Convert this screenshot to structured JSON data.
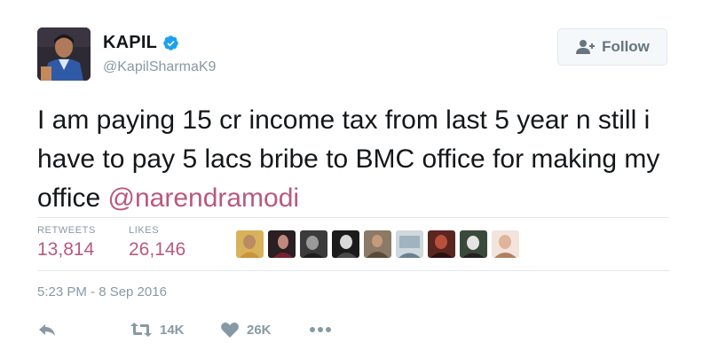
{
  "user": {
    "name": "KAPIL",
    "handle": "@KapilSharmaK9",
    "verified": true
  },
  "follow_button": {
    "label": "Follow",
    "icon": "person-plus-icon"
  },
  "tweet": {
    "text": "I am paying 15 cr income tax from last 5 year n still i have to pay 5 lacs bribe to BMC office for making my office",
    "mention": "@narendramodi"
  },
  "stats": {
    "retweets_label": "RETWEETS",
    "retweets_value": "13,814",
    "likes_label": "LIKES",
    "likes_value": "26,146"
  },
  "likers_count_shown": 9,
  "timestamp": "5:23 PM - 8 Sep 2016",
  "actions": {
    "reply_icon": "reply-icon",
    "retweet_icon": "retweet-icon",
    "retweet_count": "14K",
    "like_icon": "heart-icon",
    "like_count": "26K",
    "more_icon": "more-icon"
  },
  "colors": {
    "name": "#14171a",
    "muted": "#8899a6",
    "accent": "#b95a7a",
    "verified": "#1da1f2",
    "border": "#e1e8ed"
  }
}
